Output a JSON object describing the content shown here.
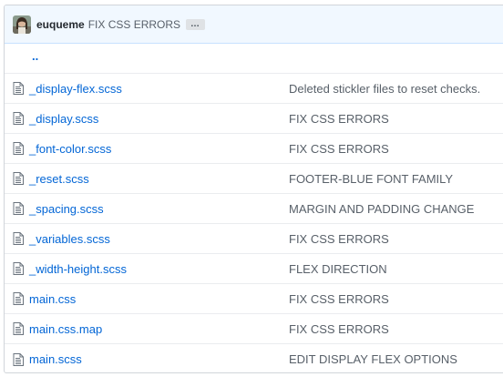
{
  "commit": {
    "author": "euqueme",
    "message": "FIX CSS ERRORS",
    "more_label": "…"
  },
  "parent_link": "..",
  "files": [
    {
      "name": "_display-flex.scss",
      "message": "Deleted stickler files to reset checks.",
      "icon": "file-icon"
    },
    {
      "name": "_display.scss",
      "message": "FIX CSS ERRORS",
      "icon": "file-icon"
    },
    {
      "name": "_font-color.scss",
      "message": "FIX CSS ERRORS",
      "icon": "file-icon"
    },
    {
      "name": "_reset.scss",
      "message": "FOOTER-BLUE FONT FAMILY",
      "icon": "file-icon"
    },
    {
      "name": "_spacing.scss",
      "message": "MARGIN AND PADDING CHANGE",
      "icon": "file-icon"
    },
    {
      "name": "_variables.scss",
      "message": "FIX CSS ERRORS",
      "icon": "file-icon"
    },
    {
      "name": "_width-height.scss",
      "message": "FLEX DIRECTION",
      "icon": "file-icon"
    },
    {
      "name": "main.css",
      "message": "FIX CSS ERRORS",
      "icon": "file-icon"
    },
    {
      "name": "main.css.map",
      "message": "FIX CSS ERRORS",
      "icon": "file-icon"
    },
    {
      "name": "main.scss",
      "message": "EDIT DISPLAY FLEX OPTIONS",
      "icon": "file-icon"
    }
  ],
  "colors": {
    "link": "#0366d6",
    "muted_text": "#586069",
    "commit_bar_bg": "#f1f8ff",
    "border": "#eaecef"
  }
}
